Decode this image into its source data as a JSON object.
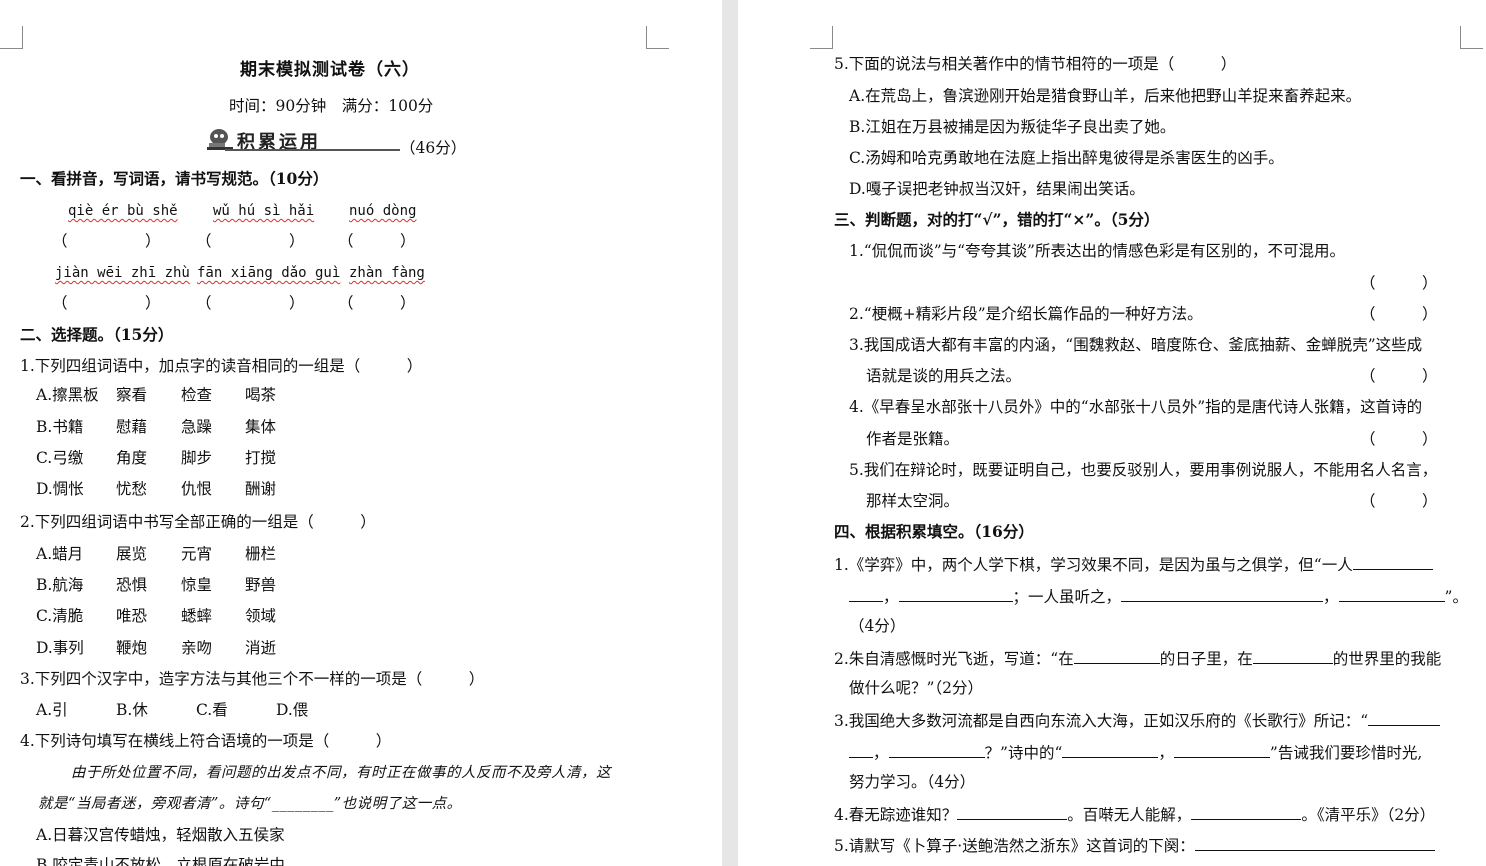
{
  "left": {
    "title": "期末模拟测试卷（六）",
    "meta": "时间：90分钟　满分：100分",
    "banner": {
      "label": "积累运用",
      "score": "（46分）"
    },
    "s1": {
      "head": "一、看拼音，写词语，请书写规范。（10分）",
      "r1": [
        "qiè ér bù shě",
        "wǔ hú sì hǎi",
        "nuó dòng"
      ],
      "r2": [
        "jiàn wēi zhī zhù",
        "fān xiāng dǎo guì",
        "zhàn fàng"
      ],
      "paren": "（　　　　　）",
      "paren_s": "（　　　）"
    },
    "s2": {
      "head": "二、选择题。（15分）",
      "q1": "1.下列四组词语中，加点字的读音相同的一组是（　　　）",
      "q1o": [
        [
          "A.擦黑板",
          "察看",
          "检查",
          "喝茶"
        ],
        [
          "B.书籍",
          "慰藉",
          "急躁",
          "集体"
        ],
        [
          "C.弓缴",
          "角度",
          "脚步",
          "打搅"
        ],
        [
          "D.惆怅",
          "忧愁",
          "仇恨",
          "酬谢"
        ]
      ],
      "q2": "2.下列四组词语中书写全部正确的一组是（　　　）",
      "q2o": [
        [
          "A.蜡月",
          "展览",
          "元宵",
          "栅栏"
        ],
        [
          "B.航海",
          "恐惧",
          "惊皇",
          "野兽"
        ],
        [
          "C.清脆",
          "唯恐",
          "蟋蟀",
          "领域"
        ],
        [
          "D.事列",
          "鞭炮",
          "亲吻",
          "消逝"
        ]
      ],
      "q3": "3.下列四个汉字中，造字方法与其他三个不一样的一项是（　　　）",
      "q3o": [
        "A.引",
        "B.休",
        "C.看",
        "D.偎"
      ],
      "q4": "4.下列诗句填写在横线上符合语境的一项是（　　　）",
      "q4p1": "由于所处位置不同，看问题的出发点不同，有时正在做事的人反而不及旁人清，这",
      "q4p2": "就是“当局者迷，旁观者清”。诗句“________”也说明了这一点。",
      "q4a": "A.日暮汉宫传蜡烛，轻烟散入五侯家",
      "q4b": "B.咬定青山不放松，立根原在破岩中"
    }
  },
  "right": {
    "q5": "5.下面的说法与相关著作中的情节相符的一项是（　　　）",
    "q5o": [
      "A.在荒岛上，鲁滨逊刚开始是猎食野山羊，后来他把野山羊捉来畜养起来。",
      "B.江姐在万县被捕是因为叛徒华子良出卖了她。",
      "C.汤姆和哈克勇敢地在法庭上指出醉鬼彼得是杀害医生的凶手。",
      "D.嘎子误把老钟叔当汉奸，结果闹出笑话。"
    ],
    "s3": {
      "head": "三、判断题，对的打“√”，错的打“×”。（5分）",
      "i1": "1.“侃侃而谈”与“夸夸其谈”所表达出的情感色彩是有区别的，不可混用。",
      "i2": "2.“梗概+精彩片段”是介绍长篇作品的一种好方法。",
      "i3a": "3.我国成语大都有丰富的内涵，“围魏救赵、暗度陈仓、釜底抽薪、金蝉脱壳”这些成",
      "i3b": "语就是谈的用兵之法。",
      "i4a": "4.《早春呈水部张十八员外》中的“水部张十八员外”指的是唐代诗人张籍，这首诗的",
      "i4b": "作者是张籍。",
      "i5a": "5.我们在辩论时，既要证明自己，也要反驳别人，要用事例说服人，不能用名人名言，",
      "i5b": "那样太空洞。",
      "paren": "（　　　）"
    },
    "s4": {
      "head": "四、根据积累填空。（16分）",
      "f1a": "1.《学弈》中，两个人学下棋，学习效果不同，是因为虽与之俱学，但“一人",
      "f1c": "，",
      "f1d": "；一人虽听之，",
      "f1e": "，",
      "f1f": "”。",
      "f1g": "（4分）",
      "f2a": "2.朱自清感慨时光飞逝，写道：“在",
      "f2b": "的日子里，在",
      "f2c": "的世界里的我能",
      "f2d": "做什么呢？”（2分）",
      "f3a": "3.我国绝大多数河流都是自西向东流入大海，正如汉乐府的《长歌行》所记：“",
      "f3b": "，",
      "f3c": "？”诗中的“",
      "f3d": "，",
      "f3e": "”告诫我们要珍惜时光,",
      "f3f": "努力学习。（4分）",
      "f4a": "4.春无踪迹谁知？",
      "f4b": "。百啭无人能解，",
      "f4c": "。《清平乐》（2分）",
      "f5a": "5.请默写《卜算子·送鲍浩然之浙东》这首词的下阕："
    }
  }
}
